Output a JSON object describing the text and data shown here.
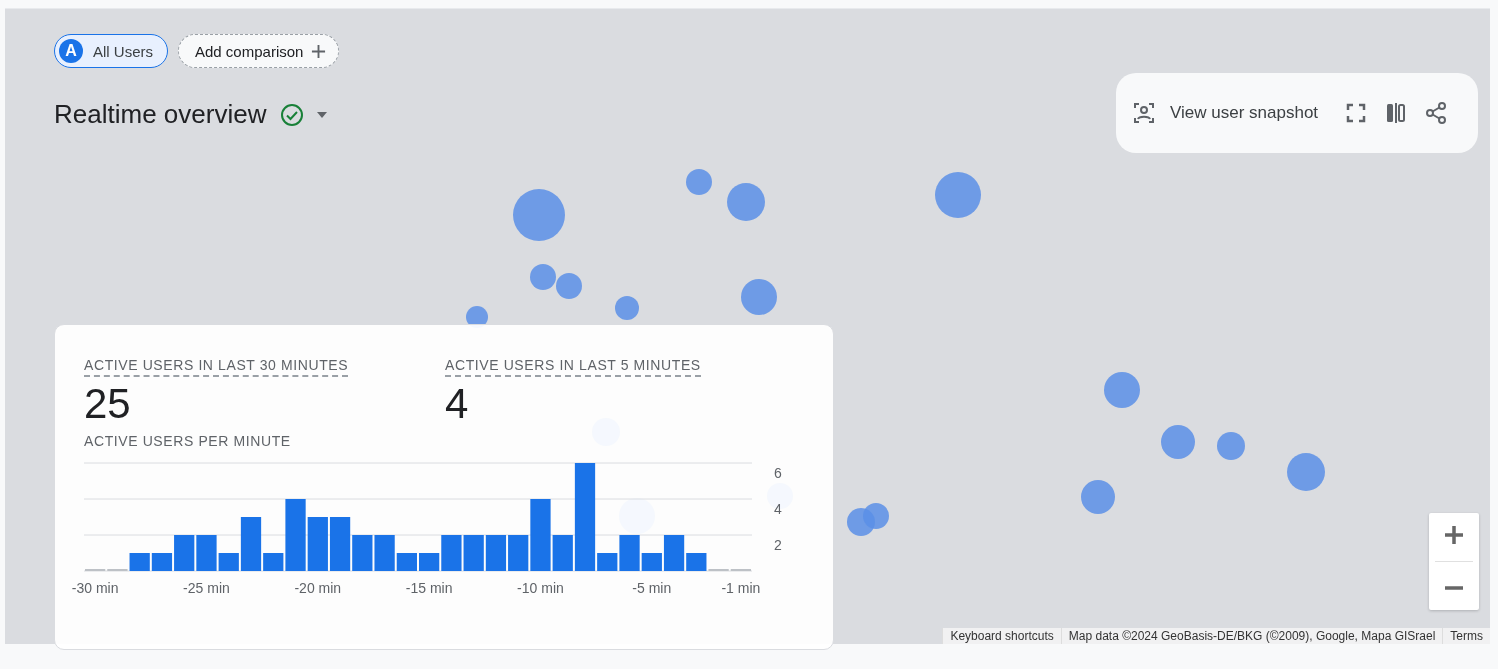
{
  "segment_chips": [
    {
      "badge": "A",
      "label": "All Users",
      "selected": true
    }
  ],
  "add_comparison": {
    "label": "Add comparison"
  },
  "title": "Realtime overview",
  "toolbar": {
    "snapshot_button": "View user snapshot"
  },
  "summary_card": {
    "metrics": [
      {
        "label": "ACTIVE USERS IN LAST 30 MINUTES",
        "value": "25"
      },
      {
        "label": "ACTIVE USERS IN LAST 5 MINUTES",
        "value": "4"
      }
    ],
    "chart_title": "ACTIVE USERS PER MINUTE",
    "chart_data": {
      "type": "bar",
      "x": [
        -30,
        -29,
        -28,
        -27,
        -26,
        -25,
        -24,
        -23,
        -22,
        -21,
        -20,
        -19,
        -18,
        -17,
        -16,
        -15,
        -14,
        -13,
        -12,
        -11,
        -10,
        -9,
        -8,
        -7,
        -6,
        -5,
        -4,
        -3,
        -2,
        -1
      ],
      "xlim": [
        -30.5,
        -0.5
      ],
      "series": [
        {
          "values": [
            0,
            0,
            1,
            1,
            2,
            2,
            1,
            3,
            1,
            4,
            3,
            3,
            2,
            2,
            1,
            1,
            2,
            2,
            2,
            2,
            4,
            2,
            6,
            1,
            2,
            1,
            2,
            1,
            0,
            0
          ]
        }
      ],
      "xticks": [
        {
          "value": -30,
          "label": "-30 min"
        },
        {
          "value": -25,
          "label": "-25 min"
        },
        {
          "value": -20,
          "label": "-20 min"
        },
        {
          "value": -15,
          "label": "-15 min"
        },
        {
          "value": -10,
          "label": "-10 min"
        },
        {
          "value": -5,
          "label": "-5 min"
        },
        {
          "value": -1,
          "label": "-1 min"
        }
      ],
      "ylim": [
        0,
        6
      ],
      "yticks": [
        2,
        4,
        6
      ]
    }
  },
  "map_attribution": [
    "Keyboard shortcuts",
    "Map data ©2024 GeoBasis-DE/BKG (©2009), Google, Mapa GISrael",
    "Terms"
  ]
}
